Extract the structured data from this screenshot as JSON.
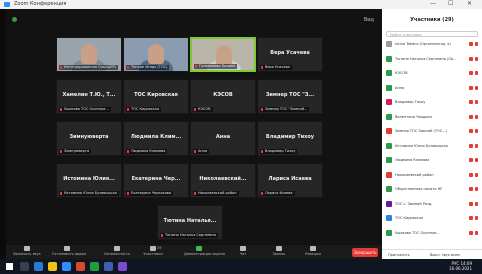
{
  "window": {
    "title": "Zoom Конференция",
    "min": "—",
    "max": "☐",
    "close": "✕"
  },
  "meeting": {
    "top_right_label": "Вид"
  },
  "tiles": [
    {
      "name": "",
      "sub": "Интегрированная Ольга(ЕР)",
      "video": true,
      "shirt": "#7a8e9a"
    },
    {
      "name": "",
      "sub": "Тенкин Игорь (ТОС)",
      "video": true,
      "shirt": "#4d6c8a"
    },
    {
      "name": "",
      "sub": "Голованова Полина",
      "video": true,
      "shirt": "#d0d0d0",
      "speaking": true
    },
    {
      "name": "Вера Усачева",
      "sub": "Вера Усачева"
    },
    {
      "name": "Хамелин Т.Ю., Т...",
      "sub": "Ушакова ТОС Окопное..."
    },
    {
      "name": "ТОС Кировская",
      "sub": "ТОС Кировская"
    },
    {
      "name": "КЭСОВ",
      "sub": "КЭСОВ"
    },
    {
      "name": "Зимнер ТОС \"З...",
      "sub": "Зимнер ТОС \"Зимний..."
    },
    {
      "name": "Зимнуюверта",
      "sub": "Зимнуюверта"
    },
    {
      "name": "Людмила Клим...",
      "sub": "Людмила Климова"
    },
    {
      "name": "Анна",
      "sub": "Анна"
    },
    {
      "name": "Владимир Тихоу",
      "sub": "Владимир Тихоу"
    },
    {
      "name": "Истомина Юлия...",
      "sub": "Истомина Юлия Бузавыцкая"
    },
    {
      "name": "Екатерина Чер...",
      "sub": "Екатерина Черкасова"
    },
    {
      "name": "Николаевский...",
      "sub": "Николаевский район"
    },
    {
      "name": "Лариса Исаева",
      "sub": "Лариса Исаева"
    },
    {
      "name": "Тютина Наталья...",
      "sub": "Тютина Наталья Сергеевна"
    }
  ],
  "toolbar": {
    "items": [
      {
        "label": "Включить звук"
      },
      {
        "label": "Остановить видео"
      },
      {
        "label": "Безопасность"
      },
      {
        "label": "Участники",
        "count": "29"
      },
      {
        "label": "Демонстрация экрана"
      },
      {
        "label": "Чат"
      },
      {
        "label": "Запись"
      },
      {
        "label": "Реакции"
      }
    ],
    "end_label": "Завершить"
  },
  "panel": {
    "title": "Участники (29)",
    "search_placeholder": "Найти участника",
    "participants": [
      {
        "name": "Iutina Tatiana (Организатор, я)",
        "color": "#9c9c9c"
      },
      {
        "name": "Тютина Наталья Сергеевна (Ор...",
        "color": "#2e9b4a"
      },
      {
        "name": "КЭСОВ",
        "color": "#2e9b4a"
      },
      {
        "name": "Анна",
        "color": "#2e9b4a"
      },
      {
        "name": "Владимир Тихоу",
        "color": "#d81b60"
      },
      {
        "name": "Валентина Чердыня",
        "color": "#2e9b4a"
      },
      {
        "name": "Зимнер ТОС Зимний (ТОС...)",
        "color": "#e53935"
      },
      {
        "name": "Истомина Юлия Бузавыцкая",
        "color": "#2e9b4a"
      },
      {
        "name": "Людмила Климова",
        "color": "#2e9b4a"
      },
      {
        "name": "Николаевский район",
        "color": "#e53935"
      },
      {
        "name": "Общественная палата НР",
        "color": "#2e9b4a"
      },
      {
        "name": "ТОС с. Зимний Разд.",
        "color": "#6a1b9a"
      },
      {
        "name": "ТОС Кировская",
        "color": "#1e88e5"
      },
      {
        "name": "Ушакова ТОС Окопное...",
        "color": "#2e9b4a"
      }
    ],
    "invite_label": "Пригласить",
    "mute_all_label": "Выкл. звук всем"
  },
  "taskbar": {
    "time": "14:09",
    "date": "16.06.2021",
    "lang": "РУС"
  }
}
